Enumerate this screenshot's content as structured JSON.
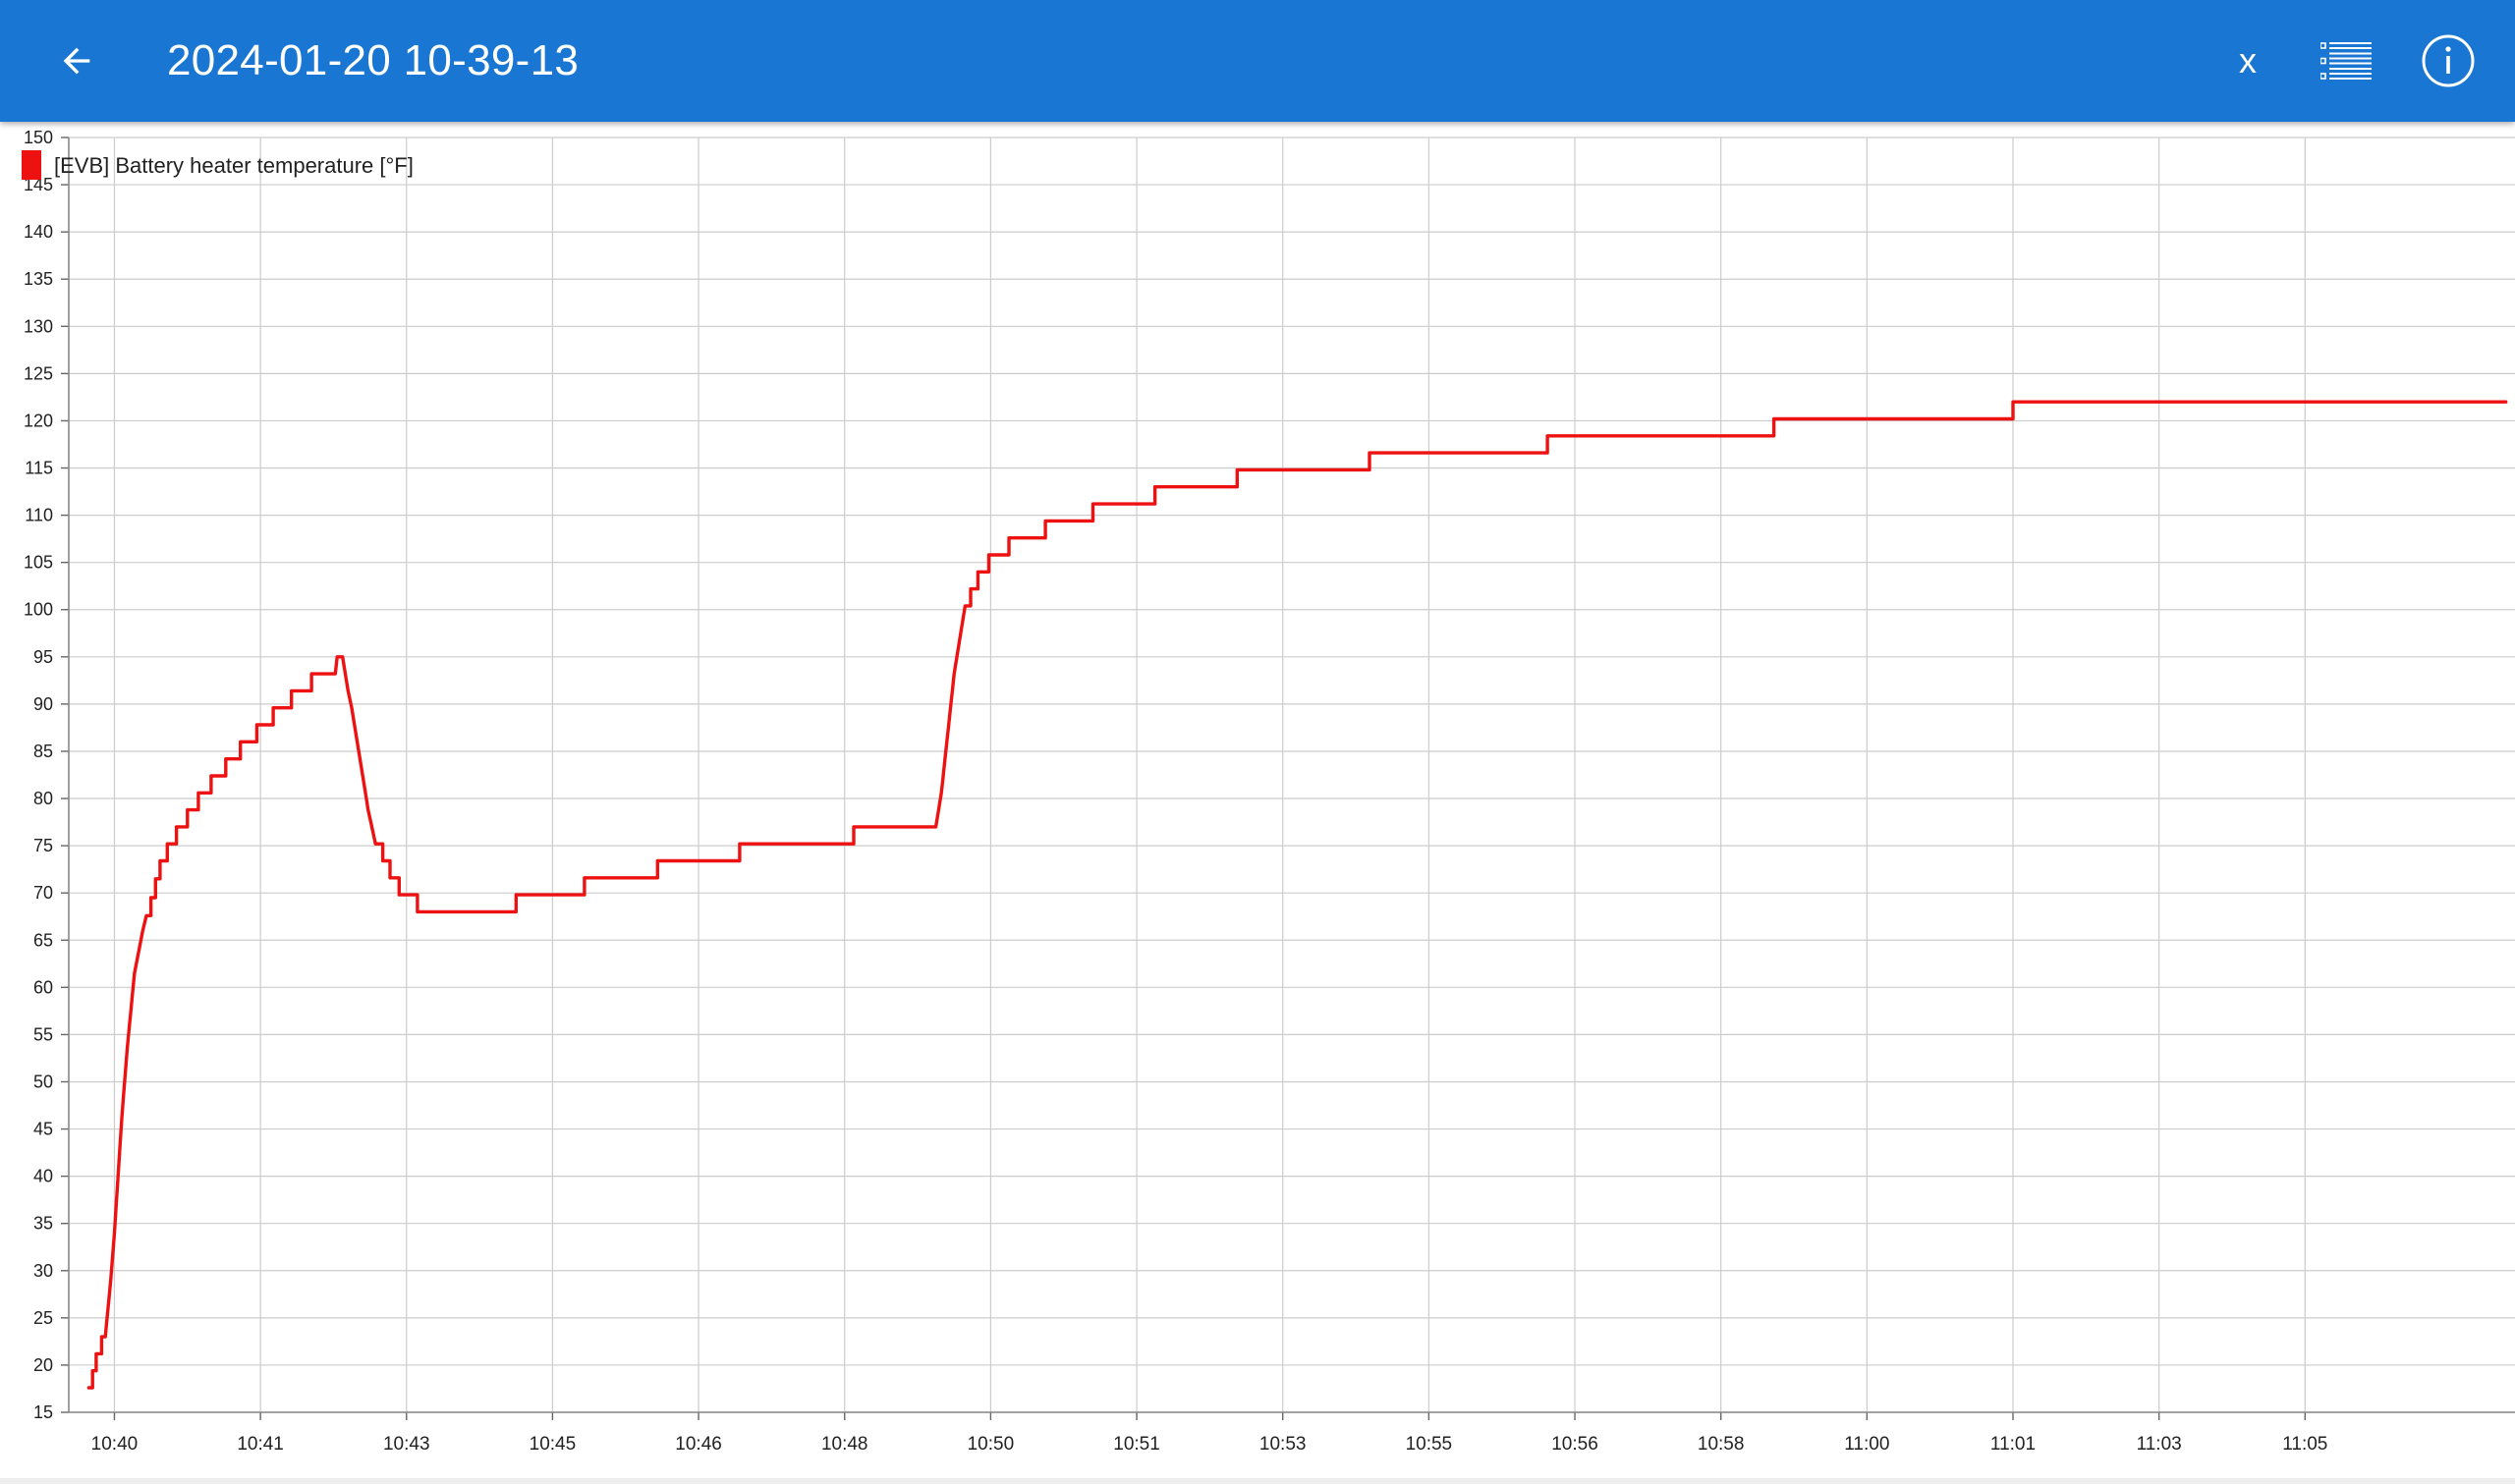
{
  "appbar": {
    "title": "2024-01-20 10-39-13",
    "x_label": "x",
    "icons": {
      "back": "arrow-back-icon",
      "list": "list-icon",
      "info": "info-icon"
    },
    "background_color": "#1976d2"
  },
  "chart_data": {
    "type": "line",
    "xlabel": "",
    "ylabel": "",
    "ylim": [
      15,
      150
    ],
    "yticks": [
      15,
      20,
      25,
      30,
      35,
      40,
      45,
      50,
      55,
      60,
      65,
      70,
      75,
      80,
      85,
      90,
      95,
      100,
      105,
      110,
      115,
      120,
      125,
      130,
      135,
      140,
      145,
      150
    ],
    "xlim_minutes": [
      639.5,
      666.3
    ],
    "xticks": [
      "10:40",
      "10:41",
      "10:43",
      "10:45",
      "10:46",
      "10:48",
      "10:50",
      "10:51",
      "10:53",
      "10:55",
      "10:56",
      "10:58",
      "11:00",
      "11:01",
      "11:03",
      "11:05"
    ],
    "xtick_minutes": [
      640.0,
      641.6,
      643.2,
      644.8,
      646.4,
      648.0,
      649.6,
      651.2,
      652.8,
      654.4,
      656.0,
      657.6,
      659.2,
      660.8,
      662.4,
      664.0
    ],
    "grid": true,
    "legend_position": "top-left",
    "series": [
      {
        "name": "[EVB] Battery heater temperature [°F]",
        "color": "#ee1111",
        "points": [
          [
            639.72,
            17.6
          ],
          [
            639.76,
            17.6
          ],
          [
            639.76,
            19.4
          ],
          [
            639.8,
            19.4
          ],
          [
            639.8,
            21.2
          ],
          [
            639.86,
            21.2
          ],
          [
            639.86,
            23.0
          ],
          [
            639.9,
            23.0
          ],
          [
            639.92,
            25.0
          ],
          [
            639.94,
            27.0
          ],
          [
            639.96,
            29.0
          ],
          [
            639.98,
            31.5
          ],
          [
            640.0,
            34.0
          ],
          [
            640.02,
            37.0
          ],
          [
            640.04,
            40.0
          ],
          [
            640.06,
            43.0
          ],
          [
            640.08,
            46.0
          ],
          [
            640.1,
            48.5
          ],
          [
            640.12,
            51.0
          ],
          [
            640.14,
            53.5
          ],
          [
            640.16,
            55.5
          ],
          [
            640.18,
            57.5
          ],
          [
            640.2,
            59.5
          ],
          [
            640.22,
            61.5
          ],
          [
            640.25,
            63.0
          ],
          [
            640.28,
            64.5
          ],
          [
            640.31,
            66.0
          ],
          [
            640.35,
            67.6
          ],
          [
            640.4,
            67.6
          ],
          [
            640.4,
            69.5
          ],
          [
            640.45,
            69.5
          ],
          [
            640.45,
            71.5
          ],
          [
            640.5,
            71.5
          ],
          [
            640.5,
            73.4
          ],
          [
            640.58,
            73.4
          ],
          [
            640.58,
            75.2
          ],
          [
            640.68,
            75.2
          ],
          [
            640.68,
            77.0
          ],
          [
            640.8,
            77.0
          ],
          [
            640.8,
            78.8
          ],
          [
            640.92,
            78.8
          ],
          [
            640.92,
            80.6
          ],
          [
            641.06,
            80.6
          ],
          [
            641.06,
            82.4
          ],
          [
            641.22,
            82.4
          ],
          [
            641.22,
            84.2
          ],
          [
            641.38,
            84.2
          ],
          [
            641.38,
            86.0
          ],
          [
            641.56,
            86.0
          ],
          [
            641.56,
            87.8
          ],
          [
            641.74,
            87.8
          ],
          [
            641.74,
            89.6
          ],
          [
            641.94,
            89.6
          ],
          [
            641.94,
            91.4
          ],
          [
            642.16,
            91.4
          ],
          [
            642.16,
            93.2
          ],
          [
            642.42,
            93.2
          ],
          [
            642.44,
            95.0
          ],
          [
            642.5,
            95.0
          ],
          [
            642.53,
            93.2
          ],
          [
            642.56,
            91.4
          ],
          [
            642.6,
            89.6
          ],
          [
            642.63,
            87.8
          ],
          [
            642.66,
            86.0
          ],
          [
            642.69,
            84.2
          ],
          [
            642.72,
            82.4
          ],
          [
            642.75,
            80.6
          ],
          [
            642.78,
            78.8
          ],
          [
            642.82,
            77.0
          ],
          [
            642.86,
            75.2
          ],
          [
            642.94,
            75.2
          ],
          [
            642.94,
            73.4
          ],
          [
            643.02,
            73.4
          ],
          [
            643.02,
            71.6
          ],
          [
            643.12,
            71.6
          ],
          [
            643.12,
            69.8
          ],
          [
            643.32,
            69.8
          ],
          [
            643.32,
            68.0
          ],
          [
            644.4,
            68.0
          ],
          [
            644.4,
            69.8
          ],
          [
            645.15,
            69.8
          ],
          [
            645.15,
            71.6
          ],
          [
            645.95,
            71.6
          ],
          [
            645.95,
            73.4
          ],
          [
            646.85,
            73.4
          ],
          [
            646.85,
            75.2
          ],
          [
            648.1,
            75.2
          ],
          [
            648.1,
            77.0
          ],
          [
            649.0,
            77.0
          ],
          [
            649.03,
            78.8
          ],
          [
            649.06,
            80.6
          ],
          [
            649.08,
            82.4
          ],
          [
            649.1,
            84.2
          ],
          [
            649.12,
            86.0
          ],
          [
            649.14,
            87.8
          ],
          [
            649.16,
            89.6
          ],
          [
            649.18,
            91.4
          ],
          [
            649.2,
            93.2
          ],
          [
            649.23,
            95.0
          ],
          [
            649.26,
            96.8
          ],
          [
            649.29,
            98.6
          ],
          [
            649.32,
            100.4
          ],
          [
            649.38,
            100.4
          ],
          [
            649.38,
            102.2
          ],
          [
            649.46,
            102.2
          ],
          [
            649.46,
            104.0
          ],
          [
            649.58,
            104.0
          ],
          [
            649.58,
            105.8
          ],
          [
            649.8,
            105.8
          ],
          [
            649.8,
            107.6
          ],
          [
            650.2,
            107.6
          ],
          [
            650.2,
            109.4
          ],
          [
            650.72,
            109.4
          ],
          [
            650.72,
            111.2
          ],
          [
            651.4,
            111.2
          ],
          [
            651.4,
            113.0
          ],
          [
            652.3,
            113.0
          ],
          [
            652.3,
            114.8
          ],
          [
            653.75,
            114.8
          ],
          [
            653.75,
            116.6
          ],
          [
            655.7,
            116.6
          ],
          [
            655.7,
            118.4
          ],
          [
            658.18,
            118.4
          ],
          [
            658.18,
            120.2
          ],
          [
            660.8,
            120.2
          ],
          [
            660.8,
            122.0
          ],
          [
            666.2,
            122.0
          ]
        ]
      }
    ]
  }
}
